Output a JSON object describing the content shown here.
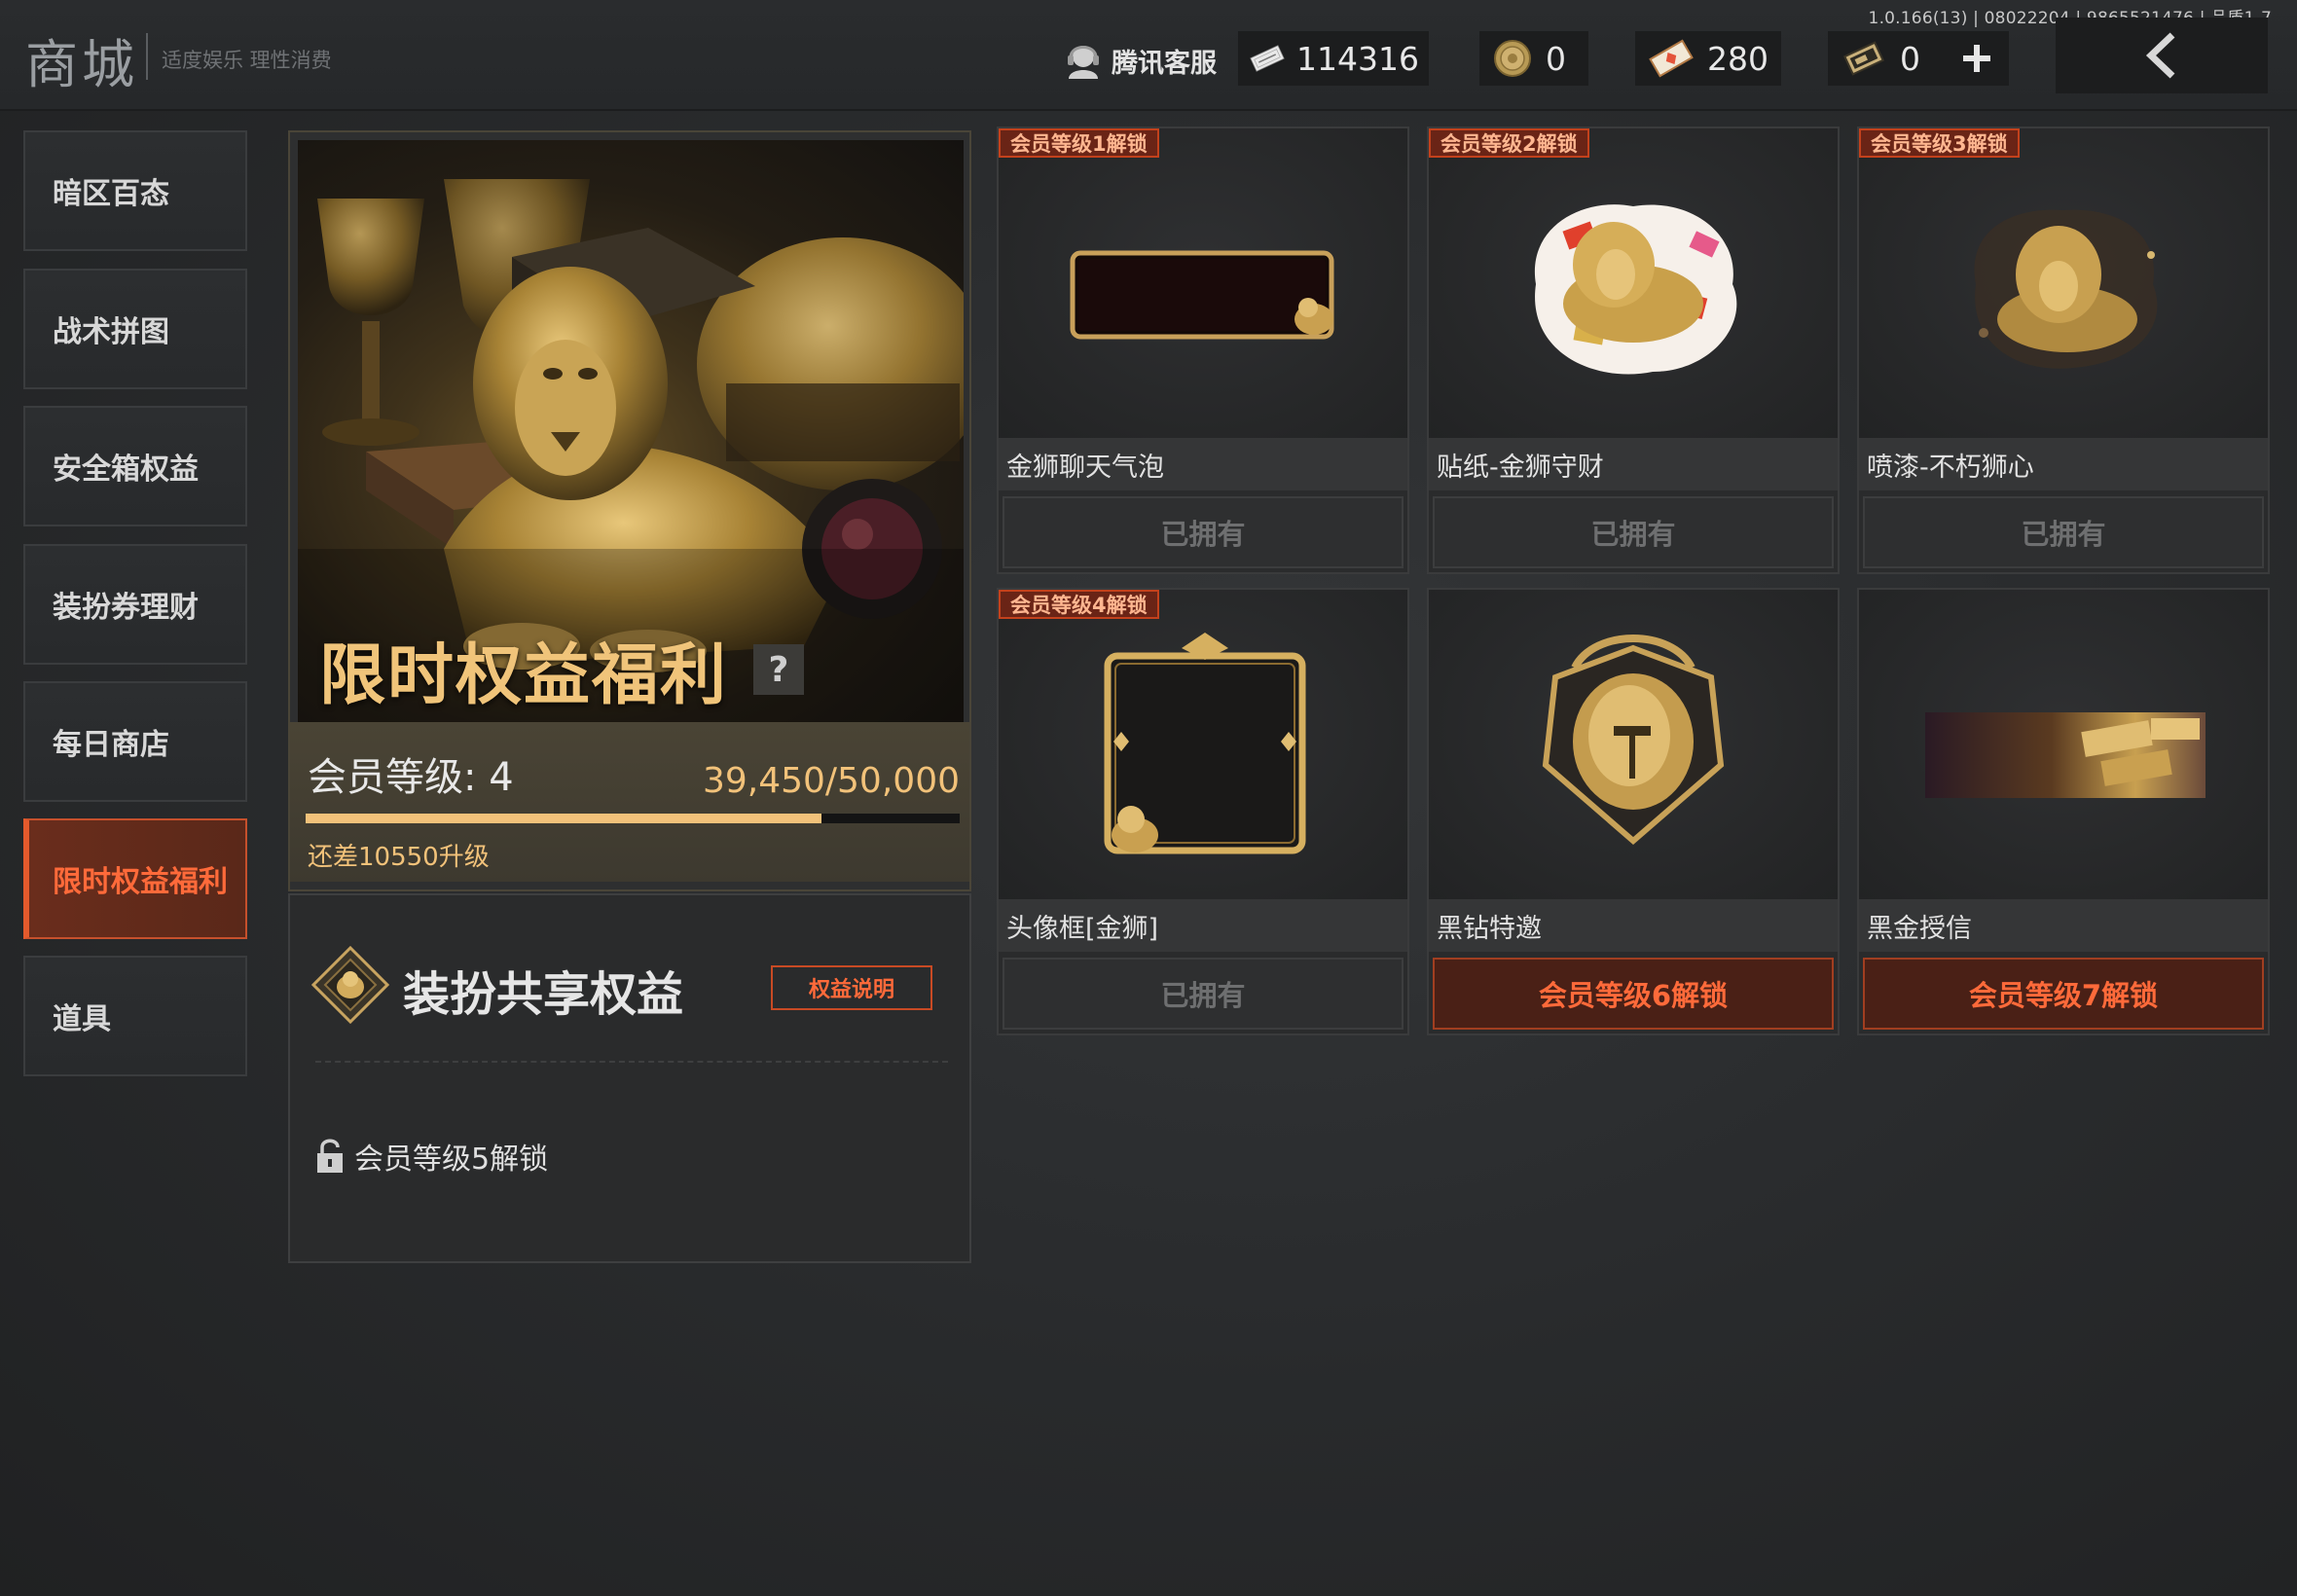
{
  "header": {
    "title": "商城",
    "subtitle": "适度娱乐 理性消费",
    "version": "1.0.166(13) | 08022204 | 9865521476 | 品质1-7",
    "customer_service": "腾讯客服",
    "currencies": [
      {
        "icon": "ticket-icon",
        "value": "114316"
      },
      {
        "icon": "coin-icon",
        "value": "0"
      },
      {
        "icon": "diamond-voucher-icon",
        "value": "280"
      },
      {
        "icon": "gold-card-icon",
        "value": "0"
      }
    ],
    "add_icon": "plus-icon",
    "back_icon": "chevron-left-icon"
  },
  "sidebar": {
    "items": [
      {
        "label": "暗区百态",
        "active": false
      },
      {
        "label": "战术拼图",
        "active": false
      },
      {
        "label": "安全箱权益",
        "active": false
      },
      {
        "label": "装扮券理财",
        "active": false
      },
      {
        "label": "每日商店",
        "active": false
      },
      {
        "label": "限时权益福利",
        "active": true
      },
      {
        "label": "道具",
        "active": false
      }
    ]
  },
  "feature": {
    "title": "限时权益福利",
    "help": "?",
    "level_label": "会员等级: 4",
    "progress_text": "39,450/50,000",
    "progress_fraction": 0.789,
    "upgrade_hint": "还差10550升级"
  },
  "shared": {
    "title": "装扮共享权益",
    "button": "权益说明",
    "lock_text": "会员等级5解锁"
  },
  "cards": [
    {
      "badge": "会员等级1解锁",
      "name": "金狮聊天气泡",
      "status": "已拥有",
      "owned": true
    },
    {
      "badge": "会员等级2解锁",
      "name": "贴纸-金狮守财",
      "status": "已拥有",
      "owned": true
    },
    {
      "badge": "会员等级3解锁",
      "name": "喷漆-不朽狮心",
      "status": "已拥有",
      "owned": true
    },
    {
      "badge": "会员等级4解锁",
      "name": "头像框[金狮]",
      "status": "已拥有",
      "owned": true
    },
    {
      "badge": "",
      "name": "黑钻特邀",
      "status": "会员等级6解锁",
      "owned": false
    },
    {
      "badge": "",
      "name": "黑金授信",
      "status": "会员等级7解锁",
      "owned": false
    }
  ],
  "colors": {
    "accent": "#ff6a3a",
    "gold": "#f2c27a",
    "background": "#2a2c2e"
  }
}
